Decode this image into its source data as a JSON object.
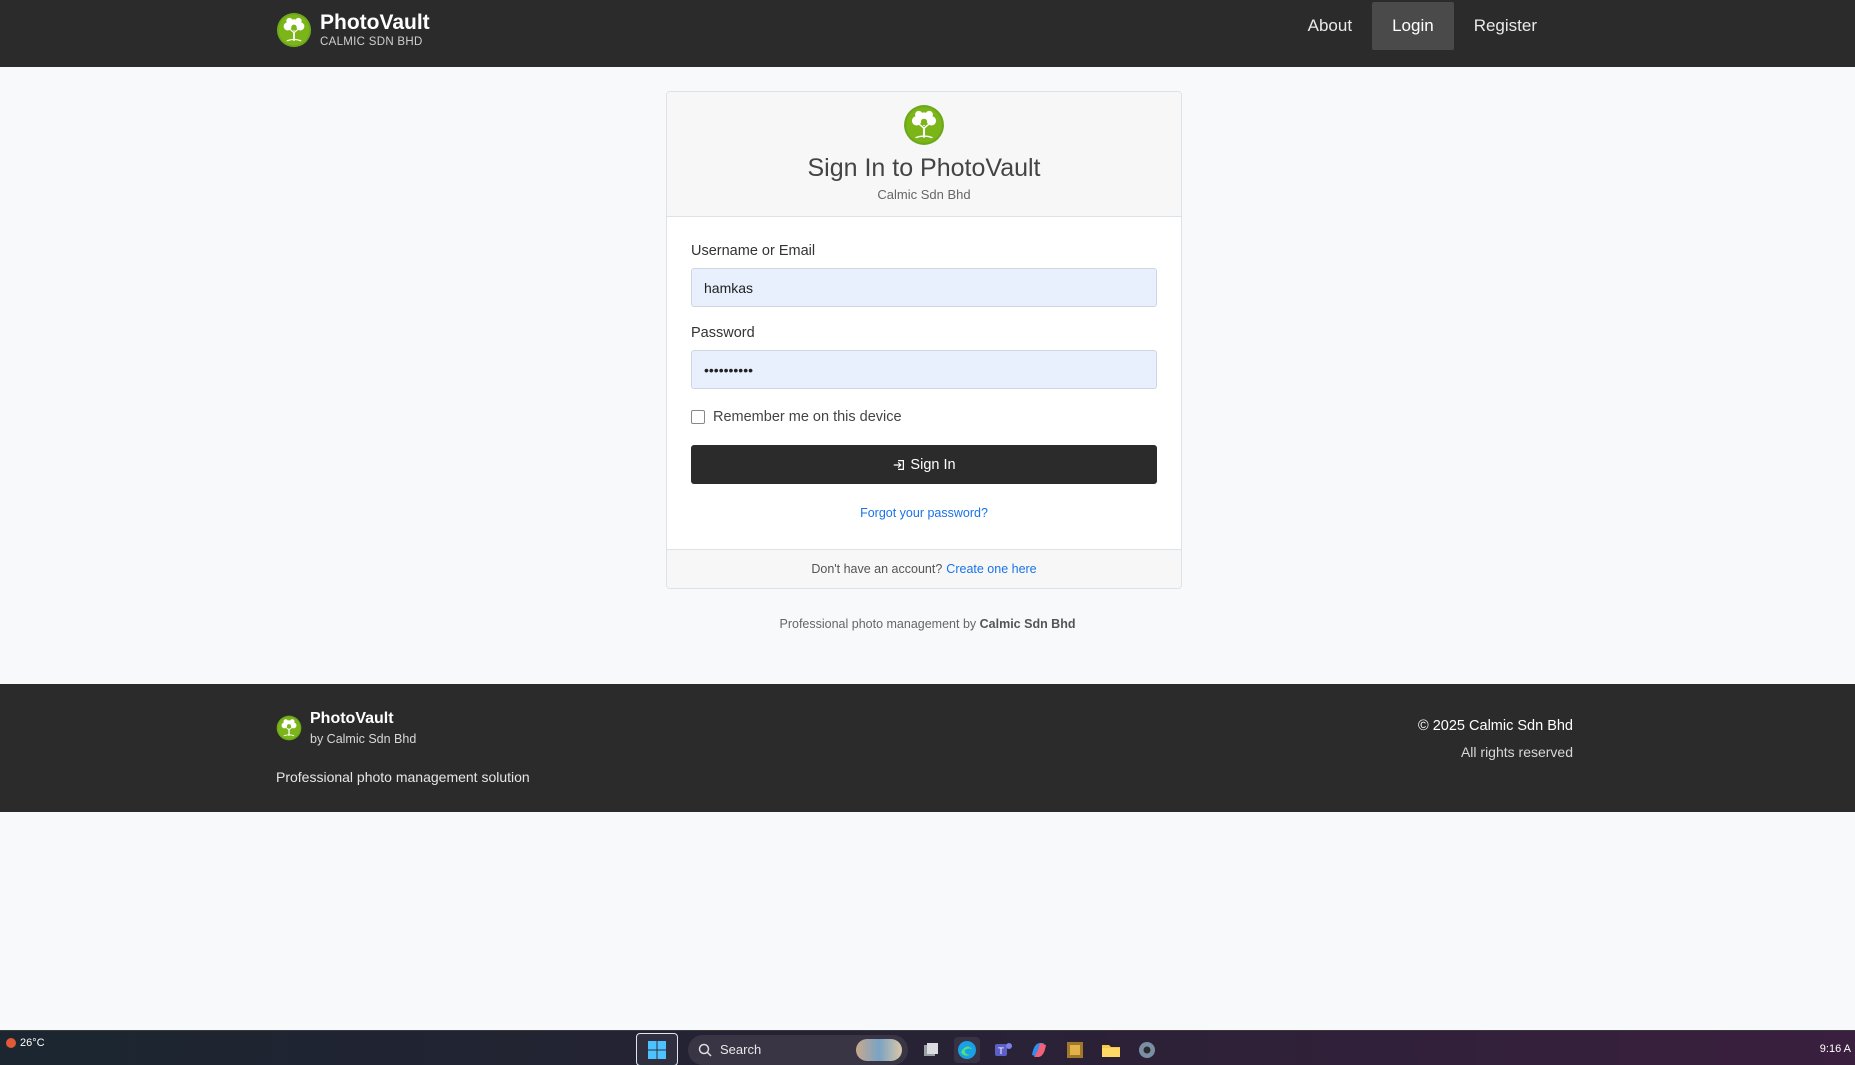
{
  "navbar": {
    "brand_title": "PhotoVault",
    "brand_subtitle": "CALMIC SDN BHD",
    "links": [
      {
        "label": "About",
        "active": false
      },
      {
        "label": "Login",
        "active": true
      },
      {
        "label": "Register",
        "active": false
      }
    ]
  },
  "login": {
    "title": "Sign In to PhotoVault",
    "subtitle": "Calmic Sdn Bhd",
    "username_label": "Username or Email",
    "username_value": "hamkas",
    "password_label": "Password",
    "password_value": "••••••••••",
    "remember_label": "Remember me on this device",
    "remember_checked": false,
    "signin_label": "Sign In",
    "forgot_label": "Forgot your password?",
    "no_account_text": "Don't have an account?",
    "create_link": "Create one here"
  },
  "tagline": {
    "text": "Professional photo management by",
    "company": "Calmic Sdn Bhd"
  },
  "footer": {
    "brand_title": "PhotoVault",
    "brand_sub": "by Calmic Sdn Bhd",
    "description": "Professional photo management solution",
    "copyright": "© 2025 Calmic Sdn Bhd",
    "rights": "All rights reserved"
  },
  "taskbar": {
    "temperature": "26°C",
    "search_label": "Search",
    "time": "9:16 A",
    "apps": [
      "task-view-icon",
      "edge-icon",
      "teams-icon",
      "copilot-icon",
      "game-icon",
      "file-explorer-icon",
      "settings-icon"
    ]
  },
  "colors": {
    "navbar_bg": "#2b2b2b",
    "logo_green": "#7cb518",
    "link_blue": "#1a73e8",
    "input_bg": "#e8f0fe"
  }
}
